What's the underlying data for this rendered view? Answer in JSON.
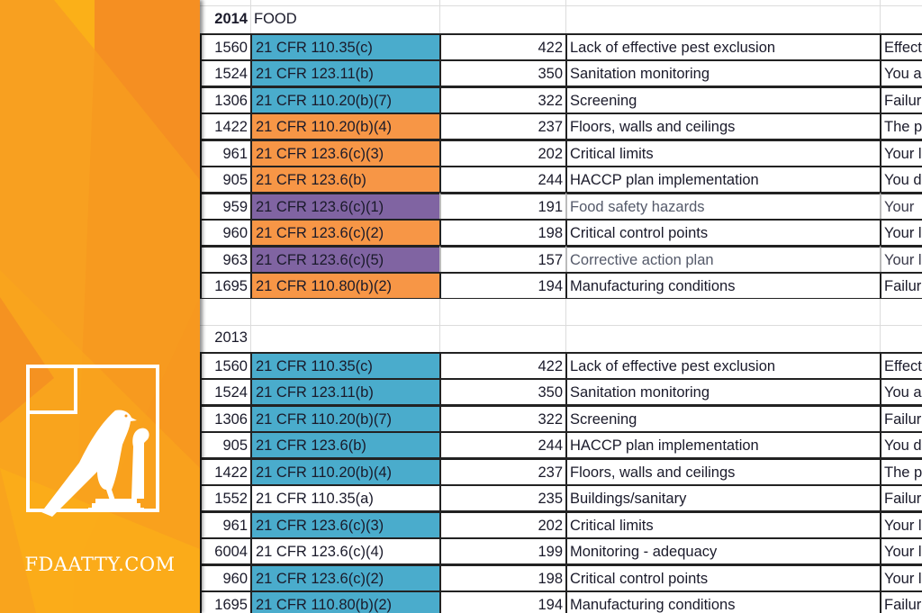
{
  "brand": {
    "site": "FDAATTY.COM",
    "logo_icon": "falcon-in-frame-icon",
    "panel_color": "#f7981f"
  },
  "colors": {
    "blue": "#4aaccc",
    "orange": "#f79646",
    "purple": "#8064a2"
  },
  "sections": [
    {
      "year": "2014",
      "year_bold": true,
      "label": "FOOD",
      "rows": [
        {
          "id": "1560",
          "cfr": "21 CFR 110.35(c)",
          "fill": "blue",
          "count": "422",
          "desc": "Lack of effective pest exclusion",
          "detail": "Effect",
          "muted": false
        },
        {
          "id": "1524",
          "cfr": "21 CFR 123.11(b)",
          "fill": "blue",
          "count": "350",
          "desc": "Sanitation monitoring",
          "detail": "You a",
          "muted": false
        },
        {
          "id": "1306",
          "cfr": "21 CFR 110.20(b)(7)",
          "fill": "blue",
          "count": "322",
          "desc": "Screening",
          "detail": "Failur",
          "muted": false
        },
        {
          "id": "1422",
          "cfr": "21 CFR 110.20(b)(4)",
          "fill": "orange",
          "count": "237",
          "desc": "Floors, walls and ceilings",
          "detail": "The p",
          "muted": false
        },
        {
          "id": "961",
          "cfr": "21 CFR 123.6(c)(3)",
          "fill": "orange",
          "count": "202",
          "desc": "Critical limits",
          "detail": "Your l",
          "muted": false
        },
        {
          "id": "905",
          "cfr": "21 CFR 123.6(b)",
          "fill": "orange",
          "count": "244",
          "desc": "HACCP plan implementation",
          "detail": "You d",
          "muted": false
        },
        {
          "id": "959",
          "cfr": "21 CFR 123.6(c)(1)",
          "fill": "purple",
          "count": "191",
          "desc": "Food safety hazards",
          "detail": "Your",
          "muted": true
        },
        {
          "id": "960",
          "cfr": "21 CFR 123.6(c)(2)",
          "fill": "orange",
          "count": "198",
          "desc": "Critical control points",
          "detail": "Your l",
          "muted": false
        },
        {
          "id": "963",
          "cfr": "21 CFR 123.6(c)(5)",
          "fill": "purple",
          "count": "157",
          "desc": "Corrective action plan",
          "detail": "Your l",
          "muted": true
        },
        {
          "id": "1695",
          "cfr": "21 CFR 110.80(b)(2)",
          "fill": "orange",
          "count": "194",
          "desc": "Manufacturing conditions",
          "detail": "Failur",
          "muted": false
        }
      ]
    },
    {
      "year": "2013",
      "year_bold": false,
      "label": "",
      "rows": [
        {
          "id": "1560",
          "cfr": "21 CFR 110.35(c)",
          "fill": "blue",
          "count": "422",
          "desc": "Lack of effective pest exclusion",
          "detail": "Effect",
          "muted": false
        },
        {
          "id": "1524",
          "cfr": "21 CFR 123.11(b)",
          "fill": "blue",
          "count": "350",
          "desc": "Sanitation monitoring",
          "detail": "You a",
          "muted": false
        },
        {
          "id": "1306",
          "cfr": "21 CFR 110.20(b)(7)",
          "fill": "blue",
          "count": "322",
          "desc": "Screening",
          "detail": "Failur",
          "muted": false
        },
        {
          "id": "905",
          "cfr": "21 CFR 123.6(b)",
          "fill": "blue",
          "count": "244",
          "desc": "HACCP plan implementation",
          "detail": "You d",
          "muted": false
        },
        {
          "id": "1422",
          "cfr": "21 CFR 110.20(b)(4)",
          "fill": "blue",
          "count": "237",
          "desc": "Floors, walls and ceilings",
          "detail": "The p",
          "muted": false
        },
        {
          "id": "1552",
          "cfr": "21 CFR 110.35(a)",
          "fill": "none",
          "count": "235",
          "desc": "Buildings/sanitary",
          "detail": "Failur",
          "muted": false
        },
        {
          "id": "961",
          "cfr": "21 CFR 123.6(c)(3)",
          "fill": "blue",
          "count": "202",
          "desc": "Critical limits",
          "detail": "Your l",
          "muted": false
        },
        {
          "id": "6004",
          "cfr": "21 CFR 123.6(c)(4)",
          "fill": "none",
          "count": "199",
          "desc": "Monitoring - adequacy",
          "detail": "Your l",
          "muted": false
        },
        {
          "id": "960",
          "cfr": "21 CFR 123.6(c)(2)",
          "fill": "blue",
          "count": "198",
          "desc": "Critical control points",
          "detail": "Your l",
          "muted": false
        },
        {
          "id": "1695",
          "cfr": "21 CFR 110.80(b)(2)",
          "fill": "blue",
          "count": "194",
          "desc": "Manufacturing conditions",
          "detail": "Failur",
          "muted": false
        }
      ]
    }
  ]
}
